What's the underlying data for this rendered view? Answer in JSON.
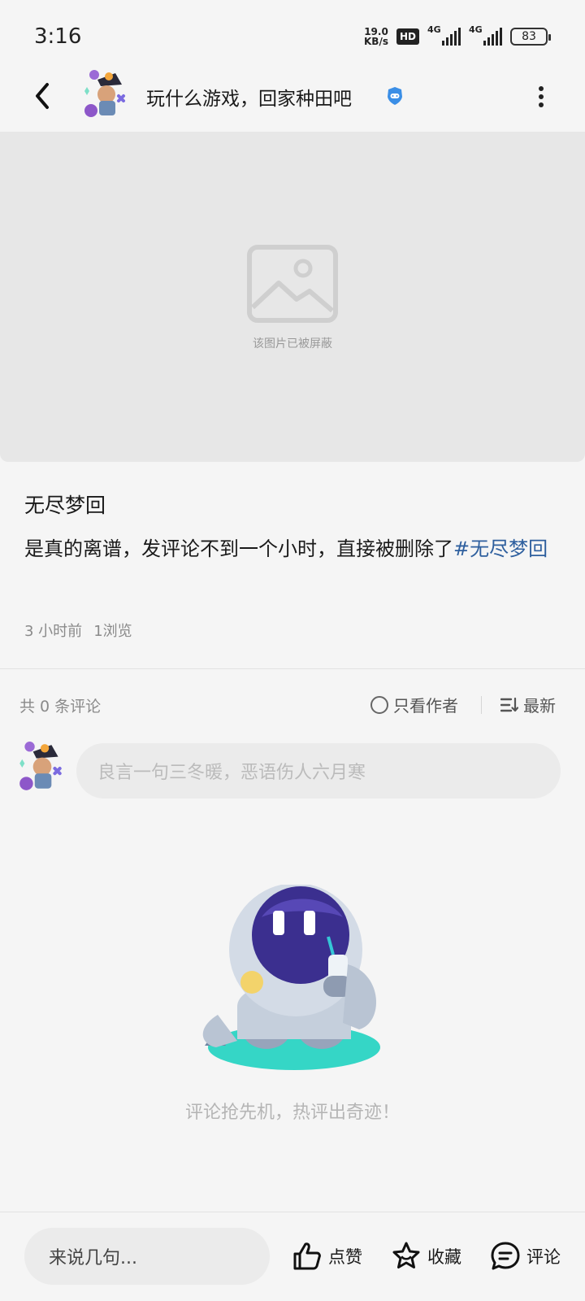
{
  "status": {
    "time": "3:16",
    "net_speed_value": "19.0",
    "net_speed_unit": "KB/s",
    "hd": "HD",
    "signal1": "4G",
    "signal2": "4G",
    "battery": "83"
  },
  "header": {
    "forum_title": "玩什么游戏，回家种田吧",
    "icons": [
      "back-icon",
      "avatar",
      "verified-game-icon",
      "more-icon"
    ]
  },
  "post": {
    "blocked_image_text": "该图片已被屏蔽",
    "title": "无尽梦回",
    "content": "是真的离谱，发评论不到一个小时，直接被删除了",
    "tag": "#无尽梦回",
    "time_ago": "3 小时前",
    "views": "1浏览"
  },
  "comments": {
    "count_label": "共 0 条评论",
    "only_author_label": "只看作者",
    "sort_label": "最新",
    "input_placeholder": "良言一句三冬暖，恶语伤人六月寒",
    "empty_text": "评论抢先机，热评出奇迹！"
  },
  "bottom_bar": {
    "input_placeholder": "来说几句...",
    "like_label": "点赞",
    "favorite_label": "收藏",
    "comment_label": "评论"
  },
  "colors": {
    "background": "#f5f5f5",
    "tag_link": "#2e5f9e",
    "verified_badge": "#3a8ee6",
    "mascot_face": "#3b2f8f",
    "mascot_base": "#35d6c6"
  }
}
